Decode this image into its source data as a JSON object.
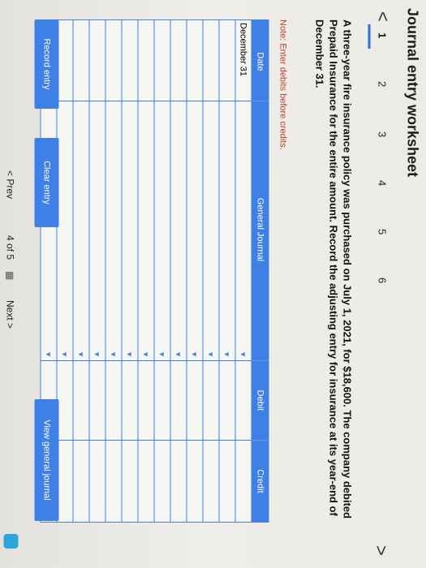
{
  "header": {
    "title": "Journal entry worksheet"
  },
  "nav": {
    "prev_symbol": "<",
    "next_symbol": ">"
  },
  "tabs": [
    "1",
    "2",
    "3",
    "4",
    "5",
    "6"
  ],
  "question": "A three-year fire insurance policy was purchased on July 1, 2021, for $18,600. The company debited Prepaid Insurance for the entire amount. Record the adjusting entry for insurance at its year-end of December 31.",
  "note": "Note: Enter debits before credits.",
  "table": {
    "headers": {
      "date": "Date",
      "account": "General Journal",
      "debit": "Debit",
      "credit": "Credit"
    },
    "rows": [
      {
        "date": "December 31"
      },
      {
        "date": ""
      },
      {
        "date": ""
      },
      {
        "date": ""
      },
      {
        "date": ""
      },
      {
        "date": ""
      },
      {
        "date": ""
      },
      {
        "date": ""
      },
      {
        "date": ""
      },
      {
        "date": ""
      },
      {
        "date": ""
      },
      {
        "date": ""
      },
      {
        "date": ""
      }
    ]
  },
  "buttons": {
    "record": "Record entry",
    "clear": "Clear entry",
    "view": "View general journal"
  },
  "pager": {
    "prev": "< Prev",
    "position": "4 of 5",
    "next": "Next >"
  }
}
